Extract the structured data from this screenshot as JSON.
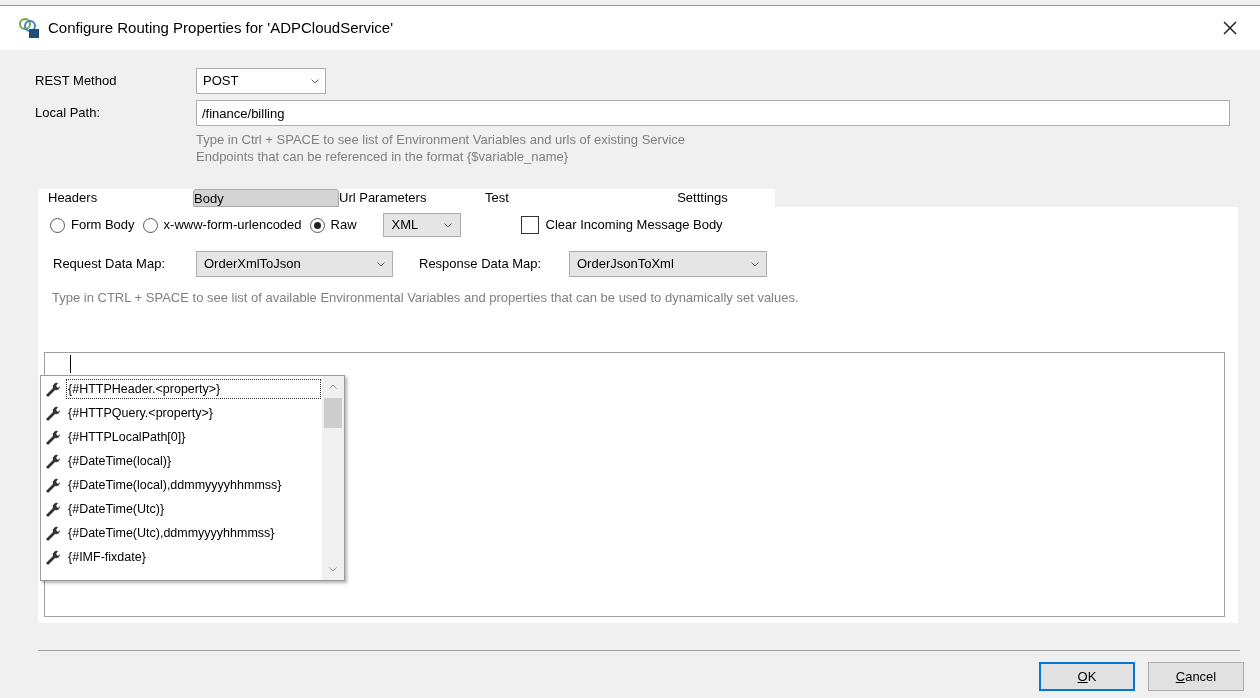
{
  "window": {
    "title": "Configure Routing Properties for 'ADPCloudService'"
  },
  "rest_method": {
    "label": "REST Method",
    "value": "POST"
  },
  "local_path": {
    "label": "Local Path:",
    "value": "/finance/billing",
    "hint": "Type in Ctrl + SPACE to see list of Environment Variables and urls of existing Service\nEndpoints that can be referenced in the format {$variable_name}"
  },
  "tabs": [
    {
      "label": "Headers",
      "selected": false
    },
    {
      "label": "Body",
      "selected": true
    },
    {
      "label": "Url Parameters",
      "selected": false
    },
    {
      "label": "Test",
      "selected": false
    },
    {
      "label": "Setttings",
      "selected": false
    }
  ],
  "body_types": [
    {
      "label": "Form Body",
      "selected": false
    },
    {
      "label": "x-www-form-urlencoded",
      "selected": false
    },
    {
      "label": "Raw",
      "selected": true
    }
  ],
  "format": {
    "value": "XML"
  },
  "clear_incoming": {
    "label": "Clear Incoming Message Body",
    "checked": false
  },
  "request_map": {
    "label": "Request Data Map:",
    "value": "OrderXmlToJson"
  },
  "response_map": {
    "label": "Response Data Map:",
    "value": "OrderJsonToXml"
  },
  "body_hint": "Type in CTRL + SPACE to see list of available Environmental Variables and properties that can be used to dynamically set values.",
  "suggestions": [
    {
      "label": "{#HTTPHeader.<property>}",
      "selected": true
    },
    {
      "label": "{#HTTPQuery.<property>}",
      "selected": false
    },
    {
      "label": "{#HTTPLocalPath[0]}",
      "selected": false
    },
    {
      "label": "{#DateTime(local)}",
      "selected": false
    },
    {
      "label": "{#DateTime(local),ddmmyyyyhhmmss}",
      "selected": false
    },
    {
      "label": "{#DateTime(Utc)}",
      "selected": false
    },
    {
      "label": "{#DateTime(Utc),ddmmyyyyhhmmss}",
      "selected": false
    },
    {
      "label": "{#IMF-fixdate}",
      "selected": false
    }
  ],
  "buttons": [
    {
      "label": "OK",
      "kind": "default"
    },
    {
      "label": "Cancel",
      "kind": "normal"
    }
  ]
}
